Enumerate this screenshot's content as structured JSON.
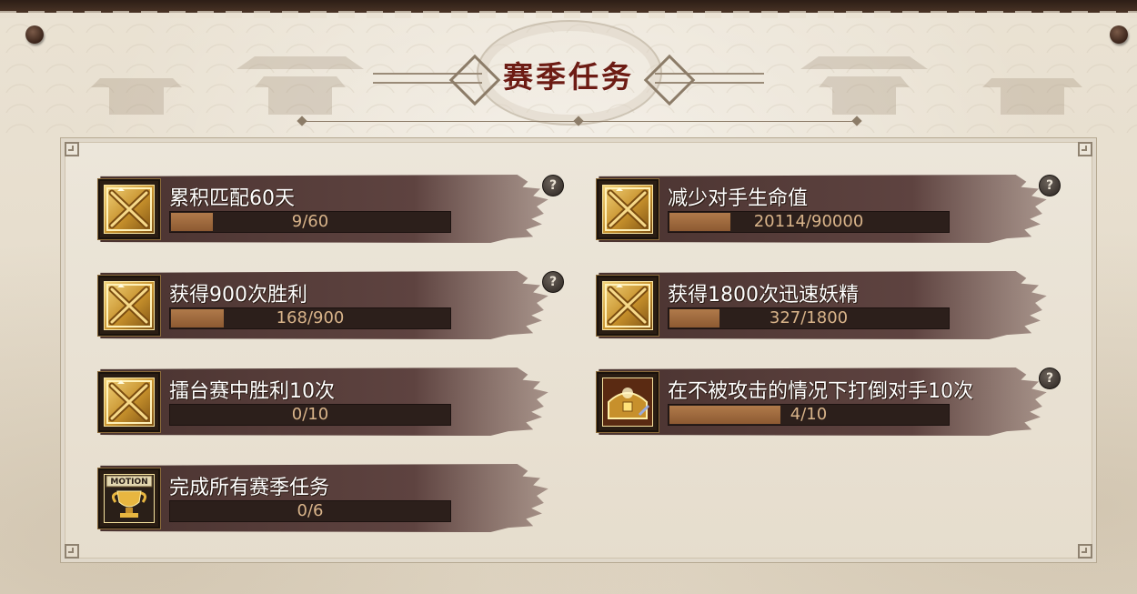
{
  "header": {
    "title": "赛季任务"
  },
  "tasks": [
    {
      "name": "累积匹配60天",
      "progress_text": "9/60",
      "progress": 0.15,
      "icon": "gold-crate-icon",
      "help": true
    },
    {
      "name": "减少对手生命值",
      "progress_text": "20114/90000",
      "progress": 0.22,
      "icon": "gold-crate-icon",
      "help": true
    },
    {
      "name": "获得900次胜利",
      "progress_text": "168/900",
      "progress": 0.19,
      "icon": "gold-crate-icon",
      "help": true
    },
    {
      "name": "获得1800次迅速妖精",
      "progress_text": "327/1800",
      "progress": 0.18,
      "icon": "gold-crate-icon",
      "help": false
    },
    {
      "name": "擂台赛中胜利10次",
      "progress_text": "0/10",
      "progress": 0,
      "icon": "gold-crate-icon",
      "help": false
    },
    {
      "name": "在不被攻击的情况下打倒对手10次",
      "progress_text": "4/10",
      "progress": 0.4,
      "icon": "treasure-chest-icon",
      "help": true
    },
    {
      "name": "完成所有赛季任务",
      "progress_text": "0/6",
      "progress": 0,
      "icon": "motion-trophy-icon",
      "icon_label": "MOTION",
      "help": false
    }
  ],
  "help_label": "?",
  "colors": {
    "title": "#6d1c14",
    "progress_fill": "#a06c40",
    "progress_track": "#2c1f1b",
    "brush": "#5e4340"
  }
}
